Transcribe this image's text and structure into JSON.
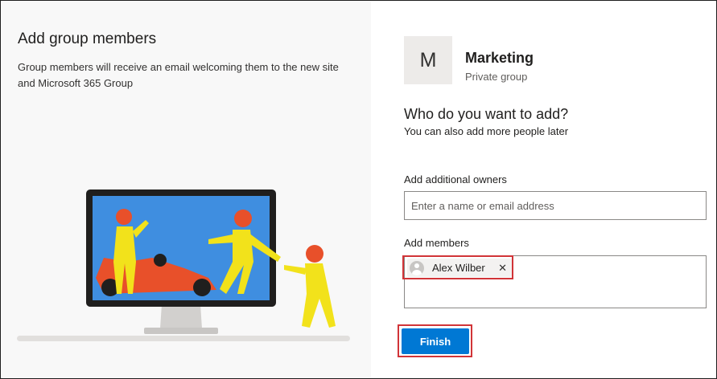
{
  "left": {
    "title": "Add group members",
    "description": "Group members will receive an email welcoming them to the new site and Microsoft 365 Group"
  },
  "group": {
    "initial": "M",
    "name": "Marketing",
    "type": "Private group"
  },
  "prompt": {
    "question": "Who do you want to add?",
    "subtext": "You can also add more people later"
  },
  "owners": {
    "label": "Add additional owners",
    "placeholder": "Enter a name or email address"
  },
  "members": {
    "label": "Add members",
    "chips": [
      {
        "name": "Alex Wilber",
        "remove_glyph": "✕"
      }
    ]
  },
  "actions": {
    "finish_label": "Finish"
  },
  "colors": {
    "primary": "#0078d4",
    "highlight": "#d13438",
    "illustration_bg": "#3f8ee0",
    "figure_yellow": "#f2e21b",
    "helmet_red": "#e8502a"
  },
  "icons": [
    "person-avatar-icon",
    "close-icon"
  ]
}
